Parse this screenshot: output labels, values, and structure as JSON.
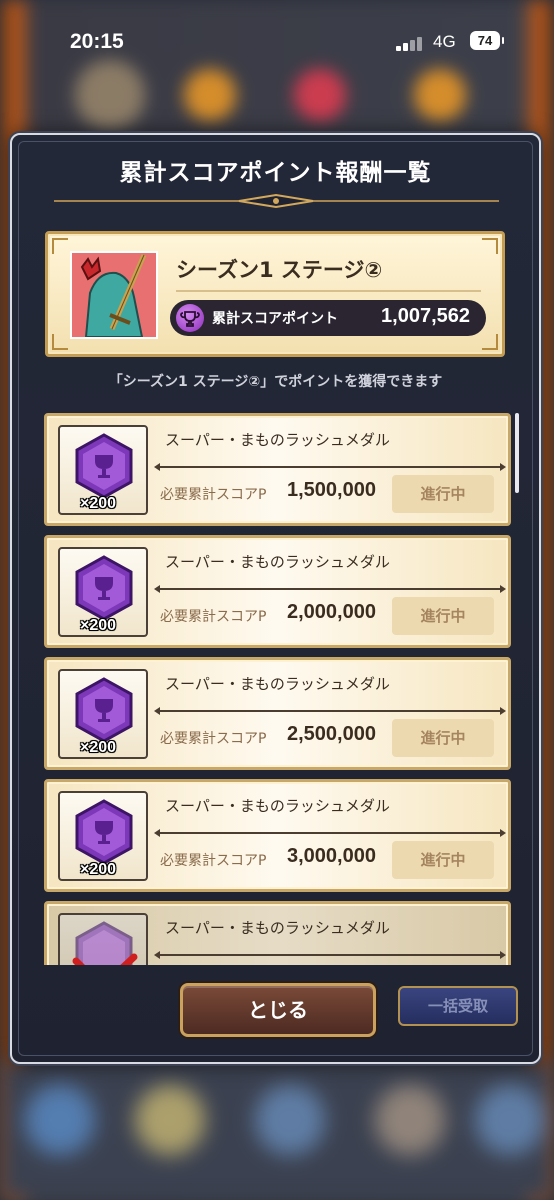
{
  "status_bar": {
    "time": "20:15",
    "network": "4G",
    "battery": "74"
  },
  "modal": {
    "title": "累計スコアポイント報酬一覧",
    "stage": {
      "name": "シーズン1 ステージ②",
      "score_label": "累計スコアポイント",
      "score_value": "1,007,562"
    },
    "subtitle": "「シーズン1 ステージ②」でポイントを獲得できます",
    "rewards": [
      {
        "item": "スーパー・まものラッシュメダル",
        "qty": "×200",
        "req_label": "必要累計スコアP",
        "req_value": "1,500,000",
        "status": "進行中"
      },
      {
        "item": "スーパー・まものラッシュメダル",
        "qty": "×200",
        "req_label": "必要累計スコアP",
        "req_value": "2,000,000",
        "status": "進行中"
      },
      {
        "item": "スーパー・まものラッシュメダル",
        "qty": "×200",
        "req_label": "必要累計スコアP",
        "req_value": "2,500,000",
        "status": "進行中"
      },
      {
        "item": "スーパー・まものラッシュメダル",
        "qty": "×200",
        "req_label": "必要累計スコアP",
        "req_value": "3,000,000",
        "status": "進行中"
      },
      {
        "item": "スーパー・まものラッシュメダル"
      }
    ],
    "close_label": "とじる",
    "bulk_label": "一括受取"
  },
  "colors": {
    "medal_purple": "#8b3fc4",
    "card_border": "#c8a869",
    "modal_bg": "#232838"
  }
}
